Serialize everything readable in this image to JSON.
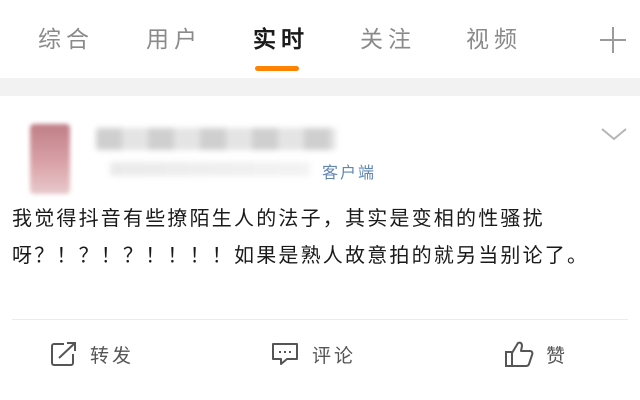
{
  "tabs": [
    {
      "label": "综合",
      "active": false
    },
    {
      "label": "用户",
      "active": false
    },
    {
      "label": "实时",
      "active": true
    },
    {
      "label": "关注",
      "active": false
    },
    {
      "label": "视频",
      "active": false
    }
  ],
  "accent_color": "#ff8200",
  "plus_icon": "plus-icon",
  "post": {
    "source_suffix": "客户端",
    "text": "我觉得抖音有些撩陌生人的法子，其实是变相的性骚扰呀？！？！？！！！！如果是熟人故意拍的就另当别论了。",
    "more_icon": "chevron-down-icon"
  },
  "actions": {
    "repost": {
      "label": "转发",
      "icon": "repost-icon"
    },
    "comment": {
      "label": "评论",
      "icon": "comment-icon"
    },
    "like": {
      "label": "赞",
      "icon": "thumbs-up-icon"
    }
  }
}
